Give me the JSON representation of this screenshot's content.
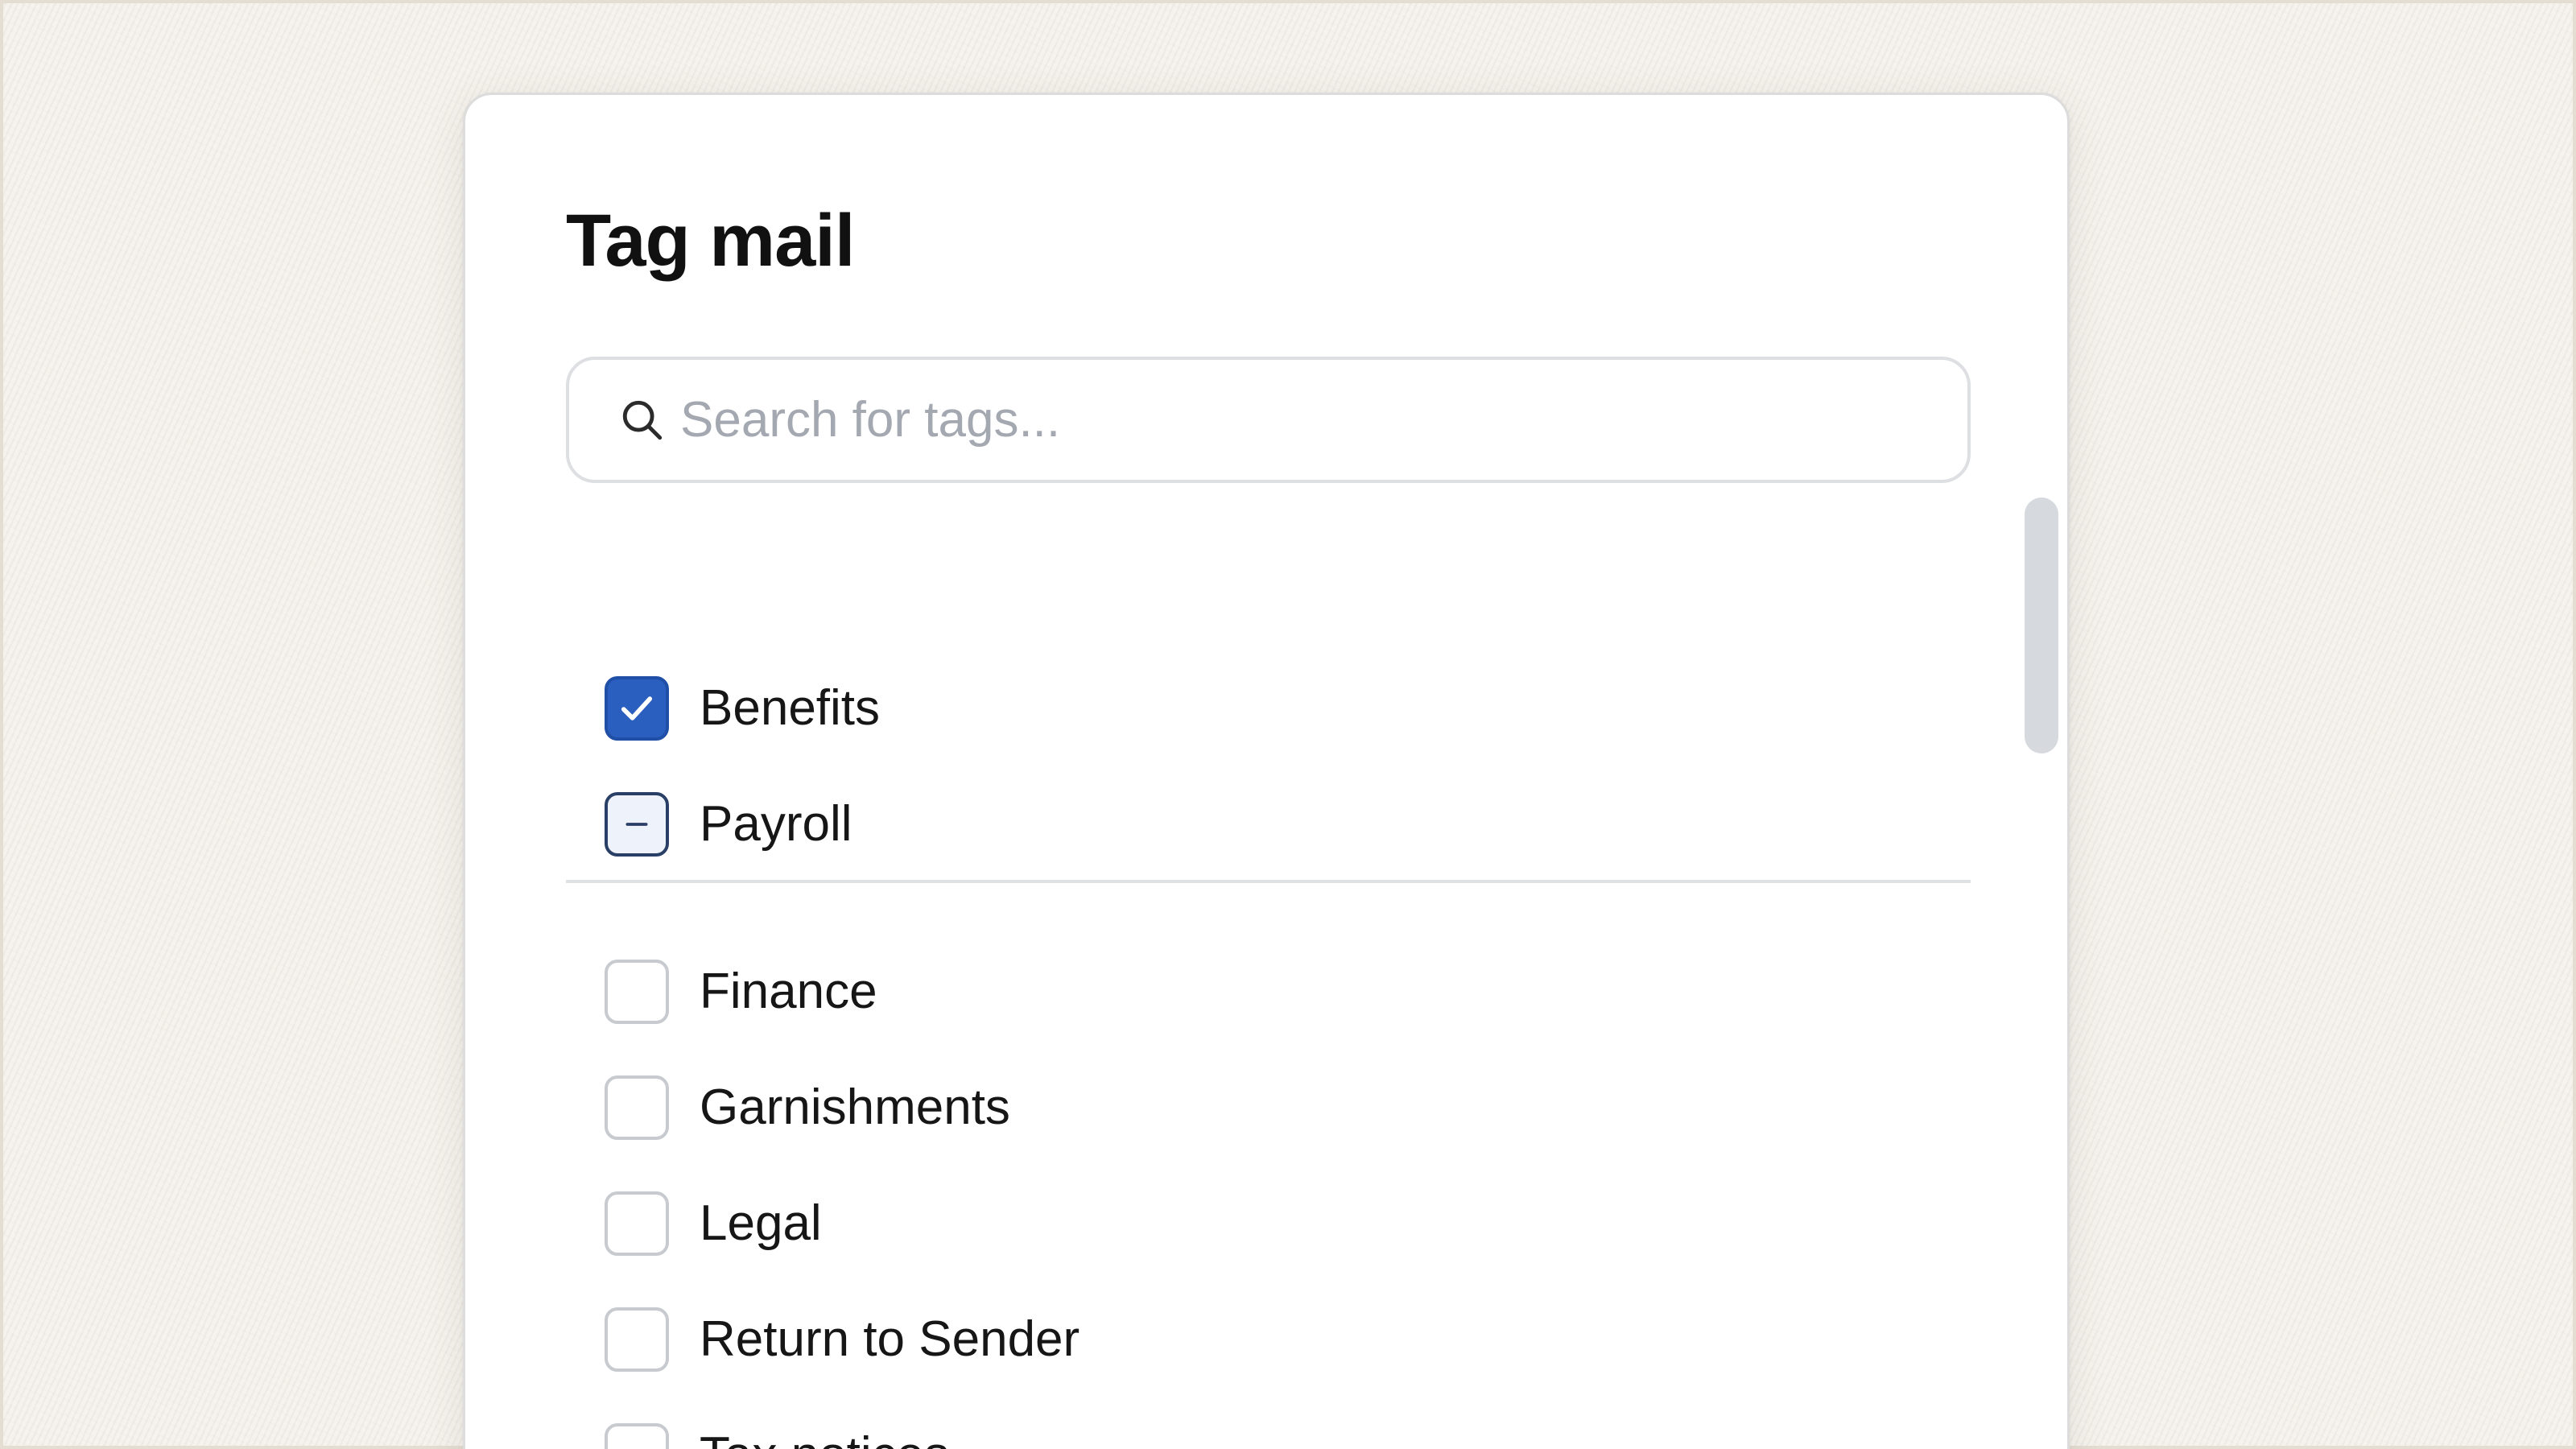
{
  "dialog": {
    "title": "Tag mail",
    "search": {
      "placeholder": "Search for tags...",
      "value": ""
    },
    "selected_tags": [
      {
        "label": "Benefits",
        "state": "checked"
      },
      {
        "label": "Payroll",
        "state": "indeterminate"
      }
    ],
    "available_tags": [
      {
        "label": "Finance",
        "state": "unchecked"
      },
      {
        "label": "Garnishments",
        "state": "unchecked"
      },
      {
        "label": "Legal",
        "state": "unchecked"
      },
      {
        "label": "Return to Sender",
        "state": "unchecked"
      },
      {
        "label": "Tax notices",
        "state": "unchecked"
      }
    ]
  },
  "icons": {
    "search": "search-icon",
    "checked": "checkmark-icon",
    "indeterminate": "minus-icon"
  },
  "colors": {
    "accent": "#2b5fbf",
    "card_background": "#ffffff",
    "page_background": "#f6f3ee",
    "placeholder_text": "#a4a8b0",
    "checkbox_border": "#c7cacf"
  }
}
